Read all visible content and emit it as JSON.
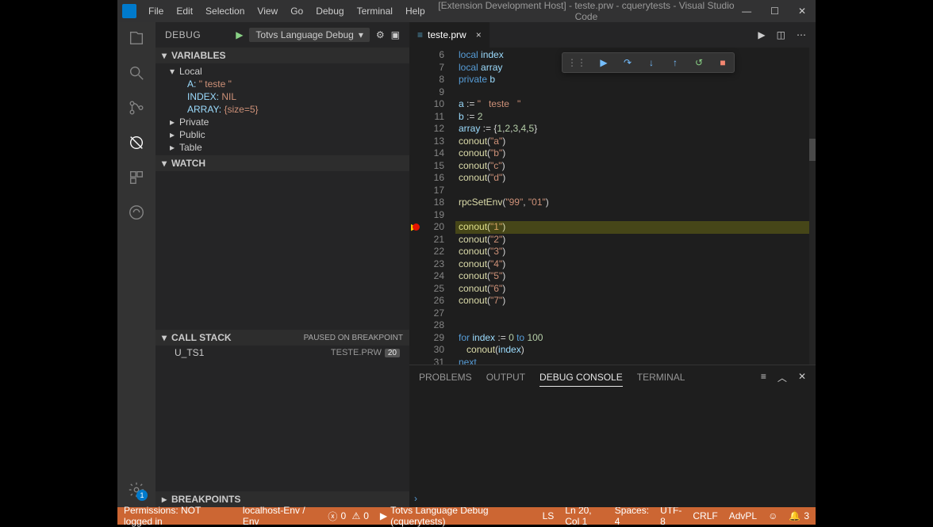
{
  "title": "[Extension Development Host] - teste.prw - cquerytests - Visual Studio Code",
  "menu": [
    "File",
    "Edit",
    "Selection",
    "View",
    "Go",
    "Debug",
    "Terminal",
    "Help"
  ],
  "debug_panel_title": "DEBUG",
  "debug_config": "Totvs Language Debug",
  "sections": {
    "variables": "VARIABLES",
    "watch": "WATCH",
    "callstack": "CALL STACK",
    "breakpoints": "BREAKPOINTS"
  },
  "vars_scopes": {
    "local": "Local",
    "private": "Private",
    "public": "Public",
    "table": "Table"
  },
  "vars_local": [
    {
      "k": "A:",
      "v": "\"   teste   \""
    },
    {
      "k": "INDEX:",
      "v": "NIL"
    },
    {
      "k": "ARRAY:",
      "v": "{size=5}"
    }
  ],
  "paused_label": "PAUSED ON BREAKPOINT",
  "callstack": {
    "fn": "U_TS1",
    "file": "TESTE.PRW",
    "line": "20"
  },
  "tab": {
    "name": "teste.prw"
  },
  "code_lines": [
    {
      "n": 6,
      "html": "<span class='kw'>local</span> <span class='ident'>index</span>"
    },
    {
      "n": 7,
      "html": "<span class='kw'>local</span> <span class='ident'>array</span>"
    },
    {
      "n": 8,
      "html": "<span class='kw'>private</span> <span class='ident'>b</span>"
    },
    {
      "n": 9,
      "html": ""
    },
    {
      "n": 10,
      "html": "<span class='ident'>a</span> := <span class='str'>\"   teste   \"</span>"
    },
    {
      "n": 11,
      "html": "<span class='ident'>b</span> := <span class='num2'>2</span>"
    },
    {
      "n": 12,
      "html": "<span class='ident'>array</span> := {<span class='num2'>1</span>,<span class='num2'>2</span>,<span class='num2'>3</span>,<span class='num2'>4</span>,<span class='num2'>5</span>}"
    },
    {
      "n": 13,
      "html": "<span class='fnc'>conout</span>(<span class='str'>\"a\"</span>)"
    },
    {
      "n": 14,
      "html": "<span class='fnc'>conout</span>(<span class='str'>\"b\"</span>)"
    },
    {
      "n": 15,
      "html": "<span class='fnc'>conout</span>(<span class='str'>\"c\"</span>)"
    },
    {
      "n": 16,
      "html": "<span class='fnc'>conout</span>(<span class='str'>\"d\"</span>)"
    },
    {
      "n": 17,
      "html": ""
    },
    {
      "n": 18,
      "html": "<span class='fnc'>rpcSetEnv</span>(<span class='str'>\"99\"</span>, <span class='str'>\"01\"</span>)"
    },
    {
      "n": 19,
      "html": ""
    },
    {
      "n": 20,
      "html": "<span class='fnc'>conout</span>(<span class='str'>\"1\"</span>)",
      "current": true
    },
    {
      "n": 21,
      "html": "<span class='fnc'>conout</span>(<span class='str'>\"2\"</span>)"
    },
    {
      "n": 22,
      "html": "<span class='fnc'>conout</span>(<span class='str'>\"3\"</span>)"
    },
    {
      "n": 23,
      "html": "<span class='fnc'>conout</span>(<span class='str'>\"4\"</span>)"
    },
    {
      "n": 24,
      "html": "<span class='fnc'>conout</span>(<span class='str'>\"5\"</span>)"
    },
    {
      "n": 25,
      "html": "<span class='fnc'>conout</span>(<span class='str'>\"6\"</span>)"
    },
    {
      "n": 26,
      "html": "<span class='fnc'>conout</span>(<span class='str'>\"7\"</span>)"
    },
    {
      "n": 27,
      "html": ""
    },
    {
      "n": 28,
      "html": ""
    },
    {
      "n": 29,
      "html": "<span class='kw'>for</span> <span class='ident'>index</span> := <span class='num2'>0</span> <span class='kw'>to</span> <span class='num2'>100</span>"
    },
    {
      "n": 30,
      "html": "   <span class='fnc'>conout</span>(<span class='ident'>index</span>)"
    },
    {
      "n": 31,
      "html": "<span class='kw'>next</span>"
    }
  ],
  "panel_tabs": {
    "problems": "PROBLEMS",
    "output": "OUTPUT",
    "debugconsole": "DEBUG CONSOLE",
    "terminal": "TERMINAL"
  },
  "status": {
    "perm": "Permissions: NOT logged in",
    "env": "localhost-Env / Env",
    "err": "0",
    "warn": "0",
    "debug": "Totvs Language Debug (cquerytests)",
    "ls": "LS",
    "lncol": "Ln 20, Col 1",
    "spaces": "Spaces: 4",
    "enc": "UTF-8",
    "eol": "CRLF",
    "lang": "AdvPL",
    "bell": "3"
  },
  "settings_badge": "1"
}
